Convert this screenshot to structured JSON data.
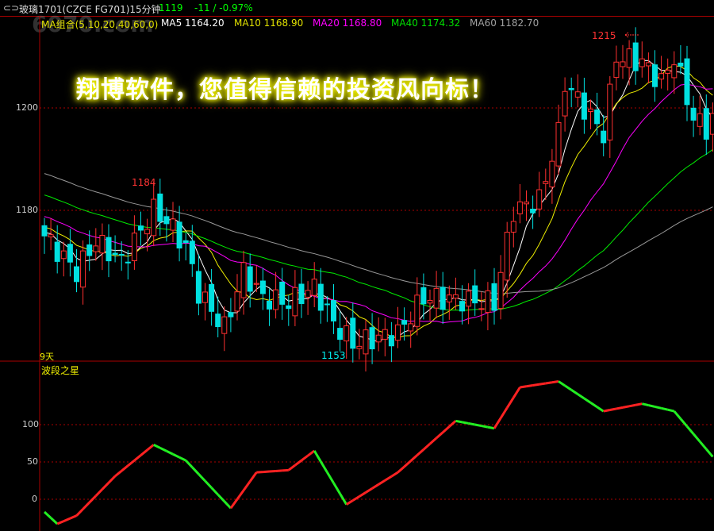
{
  "header": {
    "title": "玻璃1701(CZCE FG701)15分钟",
    "price": "1119",
    "change": "-11 / -0.97%"
  },
  "watermark": "6070.com",
  "ma_legend": [
    {
      "label": "MA组合(5,10,20,40,60,0)",
      "color": "#e0e000"
    },
    {
      "label": "MA5 1164.20",
      "color": "#ffffff"
    },
    {
      "label": "MA10 1168.90",
      "color": "#e0e000"
    },
    {
      "label": "MA20 1168.80",
      "color": "#ff00ff"
    },
    {
      "label": "MA40 1174.32",
      "color": "#00e000"
    },
    {
      "label": "MA60 1182.70",
      "color": "#a0a0a0"
    }
  ],
  "banner": "翔博软件，您值得信赖的投资风向标！",
  "price_axis": [
    "1200",
    "1180"
  ],
  "annotations": {
    "high": "1215",
    "mid_high": "1184",
    "low": "1153",
    "days": "9天"
  },
  "indicator": {
    "title": "波段之星",
    "axis": [
      "100",
      "50",
      "0"
    ]
  },
  "colors": {
    "up": "#ff3030",
    "down": "#00e0e0"
  },
  "chart_data": {
    "type": "candlestick",
    "close_anchors": [
      [
        0,
        1175
      ],
      [
        5,
        1168
      ],
      [
        8,
        1174
      ],
      [
        12,
        1170
      ],
      [
        17,
        1180
      ],
      [
        19,
        1178
      ],
      [
        22,
        1173
      ],
      [
        24,
        1164
      ],
      [
        28,
        1157
      ],
      [
        31,
        1168
      ],
      [
        34,
        1163
      ],
      [
        38,
        1162
      ],
      [
        42,
        1165
      ],
      [
        45,
        1158
      ],
      [
        48,
        1154
      ],
      [
        55,
        1156
      ],
      [
        59,
        1163
      ],
      [
        70,
        1162
      ],
      [
        73,
        1180
      ],
      [
        77,
        1182
      ],
      [
        80,
        1195
      ],
      [
        81,
        1205
      ],
      [
        84,
        1200
      ],
      [
        87,
        1195
      ],
      [
        89,
        1210
      ],
      [
        93,
        1209
      ],
      [
        96,
        1205
      ],
      [
        98,
        1210
      ],
      [
        101,
        1198
      ],
      [
        103,
        1196
      ],
      [
        104,
        1198
      ]
    ],
    "count": 105,
    "indicator_anchors": [
      [
        0,
        -17
      ],
      [
        2,
        -33
      ],
      [
        5,
        -22
      ],
      [
        11,
        31
      ],
      [
        17,
        73
      ],
      [
        22,
        52
      ],
      [
        29,
        -12
      ],
      [
        33,
        36
      ],
      [
        38,
        39
      ],
      [
        42,
        65
      ],
      [
        47,
        -7
      ],
      [
        55,
        36
      ],
      [
        64,
        105
      ],
      [
        70,
        95
      ],
      [
        74,
        150
      ],
      [
        80,
        158
      ],
      [
        87,
        118
      ],
      [
        93,
        128
      ],
      [
        98,
        118
      ],
      [
        104,
        57
      ]
    ]
  }
}
